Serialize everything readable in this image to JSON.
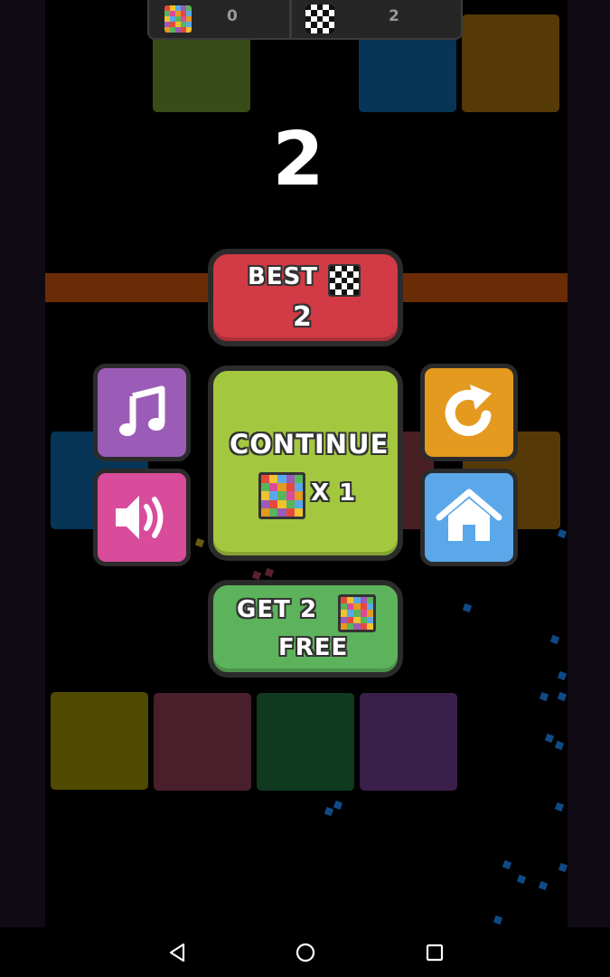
{
  "topbar": {
    "mosaic_count": "0",
    "checker_count": "2"
  },
  "score": "2",
  "best": {
    "title": "BEST",
    "value": "2"
  },
  "continue": {
    "title": "CONTINUE",
    "multiplier": "X 1"
  },
  "free": {
    "get": "GET",
    "amount": "2",
    "free": "FREE"
  },
  "icons": {
    "music": "music-note-icon",
    "sound": "speaker-icon",
    "restart": "restart-icon",
    "home": "home-icon"
  },
  "colors": {
    "best_button": "#d23a45",
    "continue_button": "#a3c83f",
    "free_button": "#5db35b",
    "music_button": "#9b5cb8",
    "sound_button": "#d84c9b",
    "restart_button": "#e4991f",
    "home_button": "#5aa8ea"
  }
}
